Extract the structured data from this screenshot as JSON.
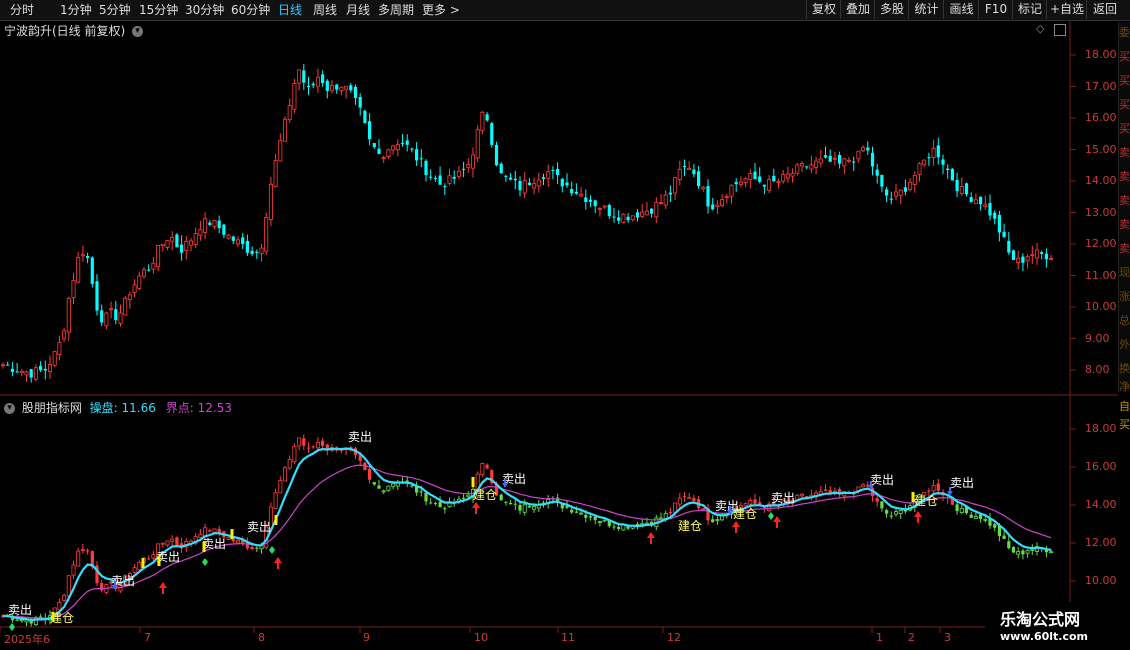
{
  "toolbar": {
    "periods": [
      "分时",
      "1分钟",
      "5分钟",
      "15分钟",
      "30分钟",
      "60分钟",
      "日线",
      "周线",
      "月线",
      "多周期",
      "更多 >"
    ],
    "active_period": "日线",
    "actions": [
      "复权",
      "叠加",
      "多股",
      "统计",
      "画线",
      "F10",
      "标记",
      "+自选",
      "返回"
    ]
  },
  "main_panel": {
    "title": "宁波韵升(日线 前复权)",
    "y_ticks": [
      "18.00",
      "17.00",
      "16.00",
      "15.00",
      "14.00",
      "13.00",
      "12.00",
      "11.00",
      "10.00",
      "9.00",
      "8.00"
    ]
  },
  "indicator_panel": {
    "name": "股朋指标网",
    "caopan_label": "操盘: 11.66",
    "jiedian_label": "界点: 12.53",
    "y_ticks": [
      "18.00",
      "16.00",
      "14.00",
      "12.00",
      "10.00"
    ],
    "sell_label": "卖出",
    "build_label": "建仓"
  },
  "x_axis_labels": [
    "2025年6",
    "7",
    "8",
    "9",
    "10",
    "11",
    "12",
    "1",
    "2",
    "3"
  ],
  "side_strip_chars": [
    "委",
    "买",
    "买",
    "买",
    "买",
    "卖",
    "卖",
    "卖",
    "卖",
    "卖",
    "现",
    "涨",
    "总",
    "外",
    "换",
    "净"
  ],
  "side_strip_chars_lower": [
    "自",
    "买"
  ],
  "watermark": {
    "title": "乐淘公式网",
    "url": "www.60lt.com"
  },
  "colors": {
    "up": "#ff3c3c",
    "down": "#00ffff",
    "caopan": "#33ddff",
    "jiedian": "#cc44cc",
    "axis": "#7a1c1c",
    "grid": "#2a0a0a",
    "active": "#32c8ff"
  },
  "icons": {
    "title_arrow": "chevron-down-icon",
    "diamond": "diamond-icon",
    "window": "window-icon"
  },
  "chart_data": {
    "type": "candlestick",
    "title": "宁波韵升(日线 前复权)",
    "ylim": [
      7.6,
      18.8
    ],
    "anchors_x": [
      0,
      30,
      45,
      55,
      62,
      70,
      78,
      85,
      90,
      95,
      100,
      105,
      110,
      115,
      120,
      125,
      130,
      140,
      150,
      160,
      170,
      180,
      190,
      200,
      210,
      220,
      230,
      240,
      250,
      260,
      270,
      275,
      280,
      285,
      290,
      295,
      300,
      305,
      310,
      315,
      320,
      325,
      330,
      340,
      350,
      360,
      370,
      375,
      380,
      390,
      400,
      410,
      420,
      430,
      440,
      450,
      460,
      470,
      480,
      485,
      490,
      495,
      500,
      510,
      520,
      530,
      540,
      550,
      560,
      570,
      580,
      590,
      600,
      610,
      620,
      630,
      640,
      650,
      660,
      670,
      680,
      690,
      700,
      710,
      720,
      730,
      740,
      750,
      760,
      770,
      780,
      790,
      800,
      810,
      820,
      830,
      840,
      850,
      860,
      865,
      870,
      875,
      880,
      890,
      900,
      910,
      920,
      930,
      935,
      940,
      950,
      960,
      970,
      980,
      990,
      1000,
      1010,
      1020,
      1025,
      1030,
      1040,
      1050
    ],
    "anchors_close": [
      8.2,
      7.9,
      8.0,
      8.5,
      9.0,
      10.5,
      11.5,
      11.9,
      11.2,
      10.2,
      9.7,
      9.6,
      9.8,
      9.7,
      9.8,
      10.1,
      10.5,
      11.0,
      11.3,
      11.9,
      12.3,
      11.8,
      12.1,
      12.6,
      12.7,
      12.5,
      12.2,
      12.0,
      11.8,
      11.7,
      13.8,
      14.5,
      15.2,
      15.8,
      16.5,
      17.2,
      17.6,
      17.0,
      16.8,
      17.2,
      17.4,
      17.0,
      16.9,
      17.1,
      16.8,
      16.2,
      15.2,
      15.0,
      14.8,
      15.1,
      15.3,
      15.0,
      14.6,
      14.2,
      13.9,
      14.0,
      14.2,
      14.6,
      15.8,
      16.3,
      15.6,
      14.8,
      14.2,
      14.0,
      13.8,
      14.0,
      14.2,
      14.3,
      14.0,
      13.8,
      13.6,
      13.4,
      13.2,
      13.0,
      12.9,
      12.9,
      13.0,
      13.1,
      13.3,
      13.6,
      14.3,
      14.5,
      13.9,
      13.2,
      13.4,
      13.8,
      14.0,
      14.1,
      14.0,
      13.9,
      14.0,
      14.2,
      14.4,
      14.5,
      14.6,
      14.6,
      14.5,
      14.7,
      14.8,
      15.2,
      14.7,
      14.3,
      13.8,
      13.4,
      13.6,
      14.0,
      14.4,
      14.9,
      15.0,
      14.8,
      14.2,
      13.7,
      13.5,
      13.4,
      13.0,
      12.4,
      11.6,
      11.4,
      11.6,
      11.7,
      11.66,
      11.66
    ]
  }
}
